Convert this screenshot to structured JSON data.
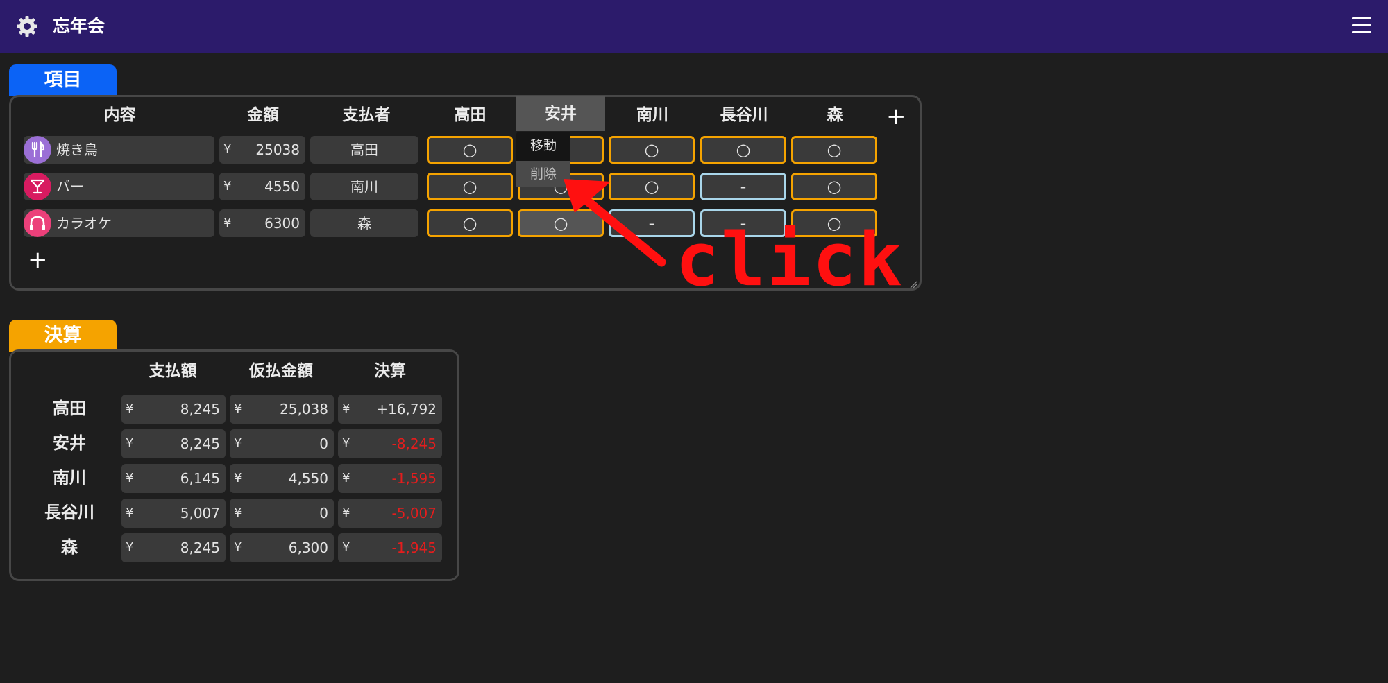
{
  "app": {
    "title": "忘年会",
    "icon": "gear-icon",
    "menu_icon": "hamburger-menu-icon"
  },
  "items_section": {
    "tab_label": "項目",
    "columns": {
      "content": "内容",
      "amount": "金額",
      "payer": "支払者"
    },
    "members": [
      "高田",
      "安井",
      "南川",
      "長谷川",
      "森"
    ],
    "add_member_label": "+",
    "add_item_label": "+",
    "currency": "¥",
    "rows": [
      {
        "icon": "fork-knife-icon",
        "icon_color": "#9b6fd6",
        "name": "焼き鳥",
        "amount": "25038",
        "payer": "高田",
        "marks": [
          "○",
          "",
          "○",
          "○",
          "○"
        ]
      },
      {
        "icon": "cocktail-icon",
        "icon_color": "#d81b60",
        "name": "バー",
        "amount": "4550",
        "payer": "南川",
        "marks": [
          "○",
          "○",
          "○",
          "-",
          "○"
        ]
      },
      {
        "icon": "headphones-icon",
        "icon_color": "#ec407a",
        "name": "カラオケ",
        "amount": "6300",
        "payer": "森",
        "marks": [
          "○",
          "○",
          "-",
          "-",
          "○"
        ]
      }
    ],
    "context_menu": {
      "move": "移動",
      "delete": "削除"
    }
  },
  "settlement_section": {
    "tab_label": "決算",
    "columns": {
      "paid": "支払額",
      "advance": "仮払金額",
      "balance": "決算"
    },
    "currency": "¥",
    "rows": [
      {
        "name": "高田",
        "paid": "8,245",
        "advance": "25,038",
        "balance": "+16,792"
      },
      {
        "name": "安井",
        "paid": "8,245",
        "advance": "0",
        "balance": "-8,245"
      },
      {
        "name": "南川",
        "paid": "6,145",
        "advance": "4,550",
        "balance": "-1,595"
      },
      {
        "name": "長谷川",
        "paid": "5,007",
        "advance": "0",
        "balance": "-5,007"
      },
      {
        "name": "森",
        "paid": "8,245",
        "advance": "6,300",
        "balance": "-1,945"
      }
    ]
  },
  "annotation": {
    "text": "click",
    "color": "#ff1010"
  },
  "colors": {
    "header_bg": "#2c1b6b",
    "items_tab": "#0b63f6",
    "settle_tab": "#f5a300",
    "cell_on_border": "#f5a300",
    "cell_off_border": "#a9d6ea",
    "negative": "#e41d1d"
  }
}
